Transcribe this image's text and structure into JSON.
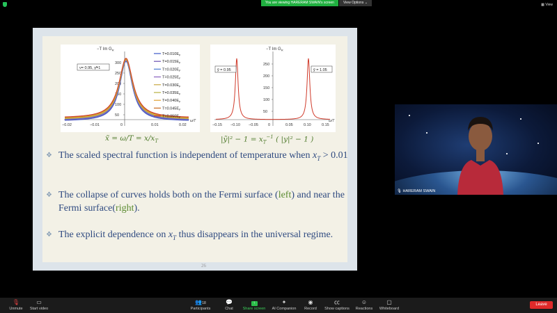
{
  "banner": {
    "viewing_text": "You are viewing HARERAM SWAIN's screen",
    "view_options": "View Options ⌄"
  },
  "top_right_view": "View",
  "slide": {
    "left_plot": {
      "ylabel": "−T Im G",
      "ylabel_sub": "R",
      "param_box": "ν= 0.95, γ̃=1",
      "x_ticks": [
        "−0.02",
        "−0.01",
        "0",
        "0.01",
        "0.02"
      ],
      "x_unit": "ω/T",
      "y_ticks": [
        "50",
        "100",
        "150",
        "200",
        "250",
        "300"
      ],
      "legend": [
        "T=0.010E",
        "T=0.015E",
        "T=0.020E",
        "T=0.025E",
        "T=0.030E",
        "T=0.035E",
        "T=0.040E",
        "T=0.045E",
        "T=0.050E"
      ],
      "legend_sub": "F",
      "legend_colors": [
        "#3b58c8",
        "#6a4fb0",
        "#4b7bd0",
        "#8a60c0",
        "#c8a640",
        "#b8b040",
        "#e0a030",
        "#c86a20",
        "#d03a2a"
      ]
    },
    "right_plot": {
      "ylabel": "−T Im G",
      "ylabel_sub": "R",
      "left_box": "ỹ = 0.95",
      "right_box": "ỹ = 1.05",
      "x_ticks": [
        "−0.15",
        "−0.10",
        "−0.05",
        "0",
        "0.05",
        "0.10",
        "0.15"
      ],
      "x_unit": "ω/T",
      "y_ticks": [
        "50",
        "100",
        "150",
        "200",
        "250"
      ]
    },
    "formula_left": "x̃ = ω/T = x/x",
    "formula_left_sub": "T",
    "formula_right": "|ỹ|² − 1 = x",
    "formula_right_sub": "T",
    "formula_right_sup": "−1",
    "formula_right_tail": "( |y|² − 1 )",
    "bullets": [
      {
        "a": "The scaled spectral function is independent of temperature when",
        "b": "x",
        "b_sub": "T",
        "c": " > 0.01"
      },
      {
        "a": "The collapse of curves holds both on the Fermi surface (",
        "left": "left",
        "mid": ") and near the Fermi surface(",
        "right": "right",
        "end": ")."
      },
      {
        "a": "The explicit dependence on ",
        "b": "x",
        "b_sub": "T",
        "c": " thus disappears in the universal regime."
      }
    ],
    "page_number": "26"
  },
  "video": {
    "participant_name": "HARERAM SWAIN"
  },
  "toolbar": {
    "unmute": "Unmute",
    "start_video": "Start video",
    "participants": "Participants",
    "participants_count": "18",
    "chat": "Chat",
    "share_screen": "Share screen",
    "ai_companion": "AI Companion",
    "record": "Record",
    "show_captions": "Show captions",
    "reactions": "Reactions",
    "whiteboard": "Whiteboard",
    "leave": "Leave"
  }
}
